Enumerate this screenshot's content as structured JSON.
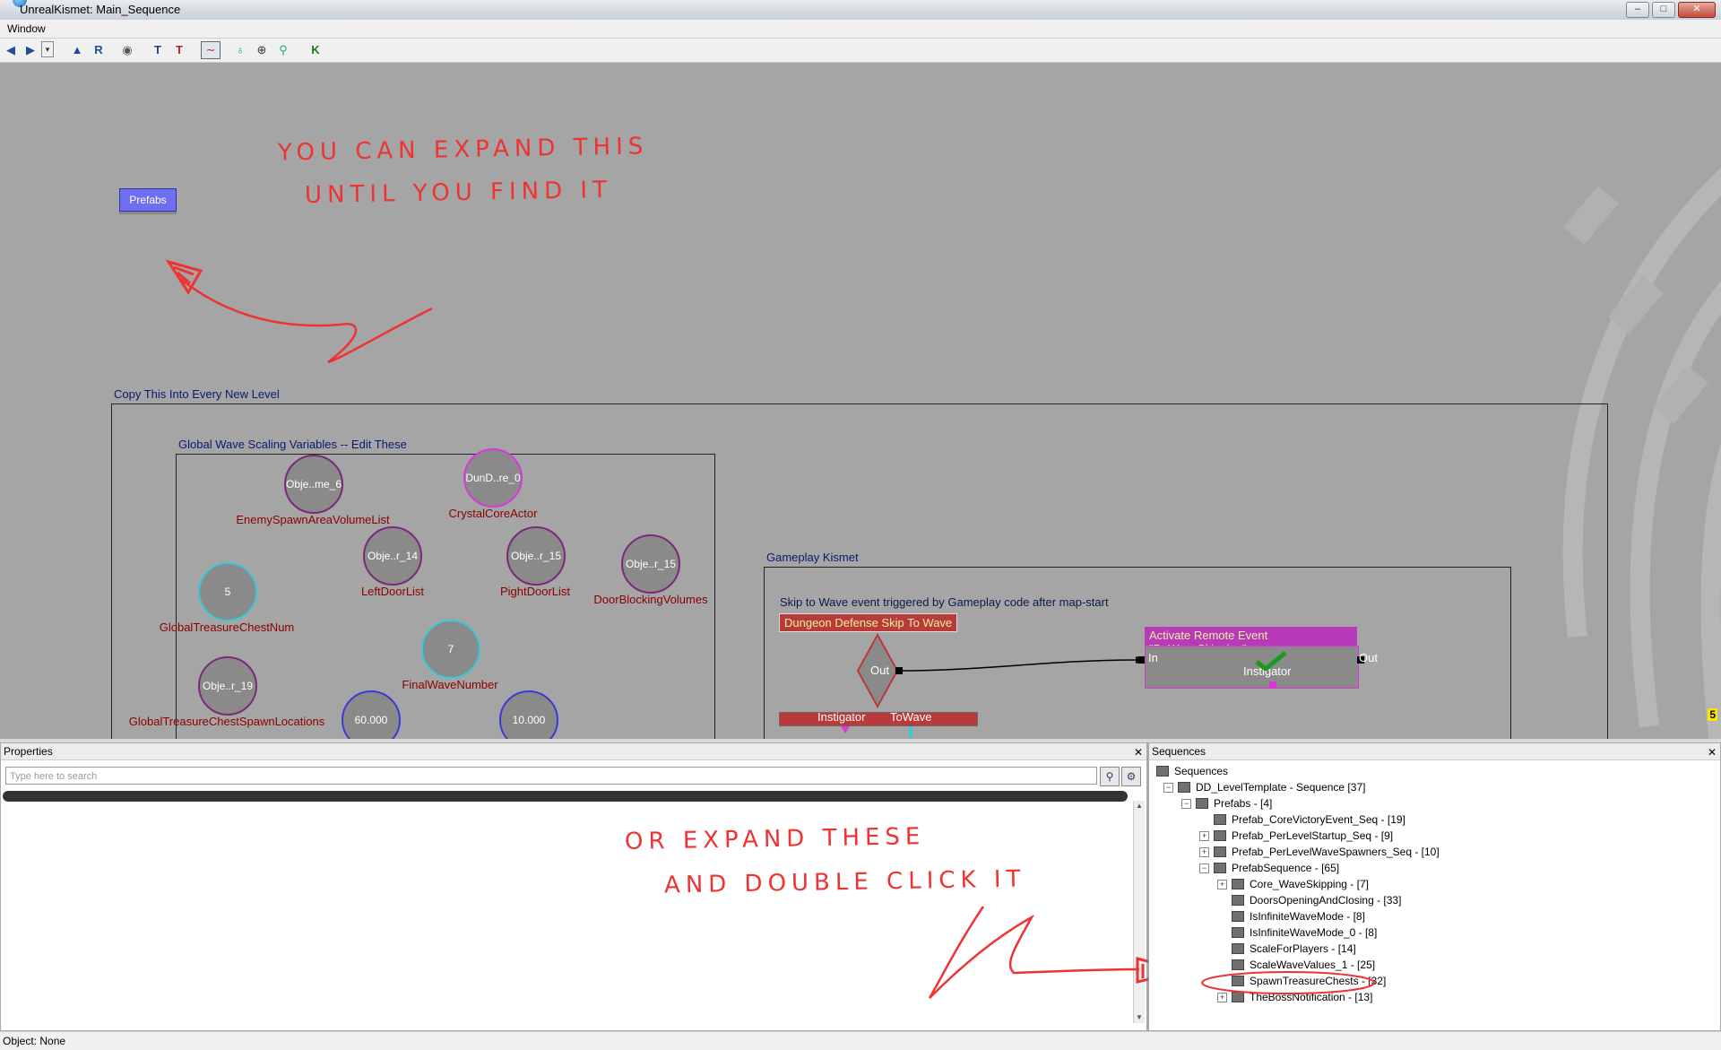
{
  "window": {
    "title": "UnrealKismet: Main_Sequence",
    "minimize": "–",
    "maximize": "□",
    "close": "✕"
  },
  "menu": {
    "window": "Window"
  },
  "toolbar": {
    "icons": [
      "back-arrow-icon",
      "forward-arrow-icon",
      "dropdown-icon",
      "up-arrow-icon",
      "refresh-icon",
      "eye-icon",
      "filter-icon",
      "filter-red-icon",
      "curve-icon",
      "lightbulb-icon",
      "zoom-icon",
      "search-icon",
      "kismet-icon"
    ]
  },
  "canvas": {
    "prefabs": "Prefabs",
    "frame_copy": "Copy This Into Every New Level",
    "frame_global": "Global Wave Scaling Variables -- Edit These",
    "frame_gameplay": "Gameplay Kismet",
    "gameplay_comment": "Skip to Wave event triggered by Gameplay code after map-start",
    "variables": [
      {
        "value": "Obje..me_6",
        "label": "EnemySpawnAreaVolumeList"
      },
      {
        "value": "DunD..re_0",
        "label": "CrystalCoreActor"
      },
      {
        "value": "Obje..r_14",
        "label": "LeftDoorList"
      },
      {
        "value": "Obje..r_15",
        "label": "PightDoorList"
      },
      {
        "value": "Obje..r_15",
        "label": "DoorBlockingVolumes"
      },
      {
        "value": "5",
        "label": "GlobalTreasureChestNum"
      },
      {
        "value": "7",
        "label": "FinalWaveNumber"
      },
      {
        "value": "Obje..r_19",
        "label": "GlobalTreasureChestSpawnLocations"
      },
      {
        "value": "60.000",
        "label": ""
      },
      {
        "value": "10.000",
        "label": ""
      }
    ],
    "event": {
      "title": "Dungeon Defense Skip To Wave",
      "out": "Out",
      "instigator": "Instigator",
      "towave": "ToWave"
    },
    "action": {
      "title": "Activate Remote Event \"DoWaveSkipping\"",
      "in": "In",
      "out": "Out",
      "instigator": "Instigator"
    },
    "corner_badge": "5"
  },
  "annotations": {
    "top_line1": "YOU CAN EXPAND THIS",
    "top_line2": "UNTIL YOU FIND IT",
    "bottom_line1": "OR EXPAND THESE",
    "bottom_line2": "AND DOUBLE CLICK IT"
  },
  "properties": {
    "header": "Properties",
    "close": "✕",
    "search_placeholder": "Type here to search"
  },
  "sequences": {
    "header": "Sequences",
    "close": "✕",
    "items": [
      {
        "label": "Sequences",
        "level": 0,
        "toggle": "",
        "icon": true
      },
      {
        "label": "DD_LevelTemplate - Sequence [37]",
        "level": 1,
        "toggle": "−",
        "icon": true
      },
      {
        "label": "Prefabs - [4]",
        "level": 2,
        "toggle": "−",
        "icon": true
      },
      {
        "label": "Prefab_CoreVictoryEvent_Seq - [19]",
        "level": 3,
        "toggle": "",
        "icon": true
      },
      {
        "label": "Prefab_PerLevelStartup_Seq - [9]",
        "level": 3,
        "toggle": "+",
        "icon": true
      },
      {
        "label": "Prefab_PerLevelWaveSpawners_Seq - [10]",
        "level": 3,
        "toggle": "+",
        "icon": true
      },
      {
        "label": "PrefabSequence - [65]",
        "level": 3,
        "toggle": "−",
        "icon": true
      },
      {
        "label": "Core_WaveSkipping - [7]",
        "level": 4,
        "toggle": "+",
        "icon": true
      },
      {
        "label": "DoorsOpeningAndClosing - [33]",
        "level": 4,
        "toggle": "",
        "icon": true
      },
      {
        "label": "IsInfiniteWaveMode - [8]",
        "level": 4,
        "toggle": "",
        "icon": true
      },
      {
        "label": "IsInfiniteWaveMode_0 - [8]",
        "level": 4,
        "toggle": "",
        "icon": true
      },
      {
        "label": "ScaleForPlayers - [14]",
        "level": 4,
        "toggle": "",
        "icon": true
      },
      {
        "label": "ScaleWaveValues_1 - [25]",
        "level": 4,
        "toggle": "",
        "icon": true
      },
      {
        "label": "SpawnTreasureChests - [32]",
        "level": 4,
        "toggle": "",
        "icon": true
      },
      {
        "label": "TheBossNotification - [13]",
        "level": 4,
        "toggle": "+",
        "icon": true
      }
    ]
  },
  "status": {
    "object": "Object: None"
  },
  "colors": {
    "annotation": "#e33333",
    "node_border_cyan": "#38c9d8",
    "node_border_blue": "#3a3ad8",
    "event_red": "#b83a3a",
    "action_magenta": "#b83ab8"
  }
}
